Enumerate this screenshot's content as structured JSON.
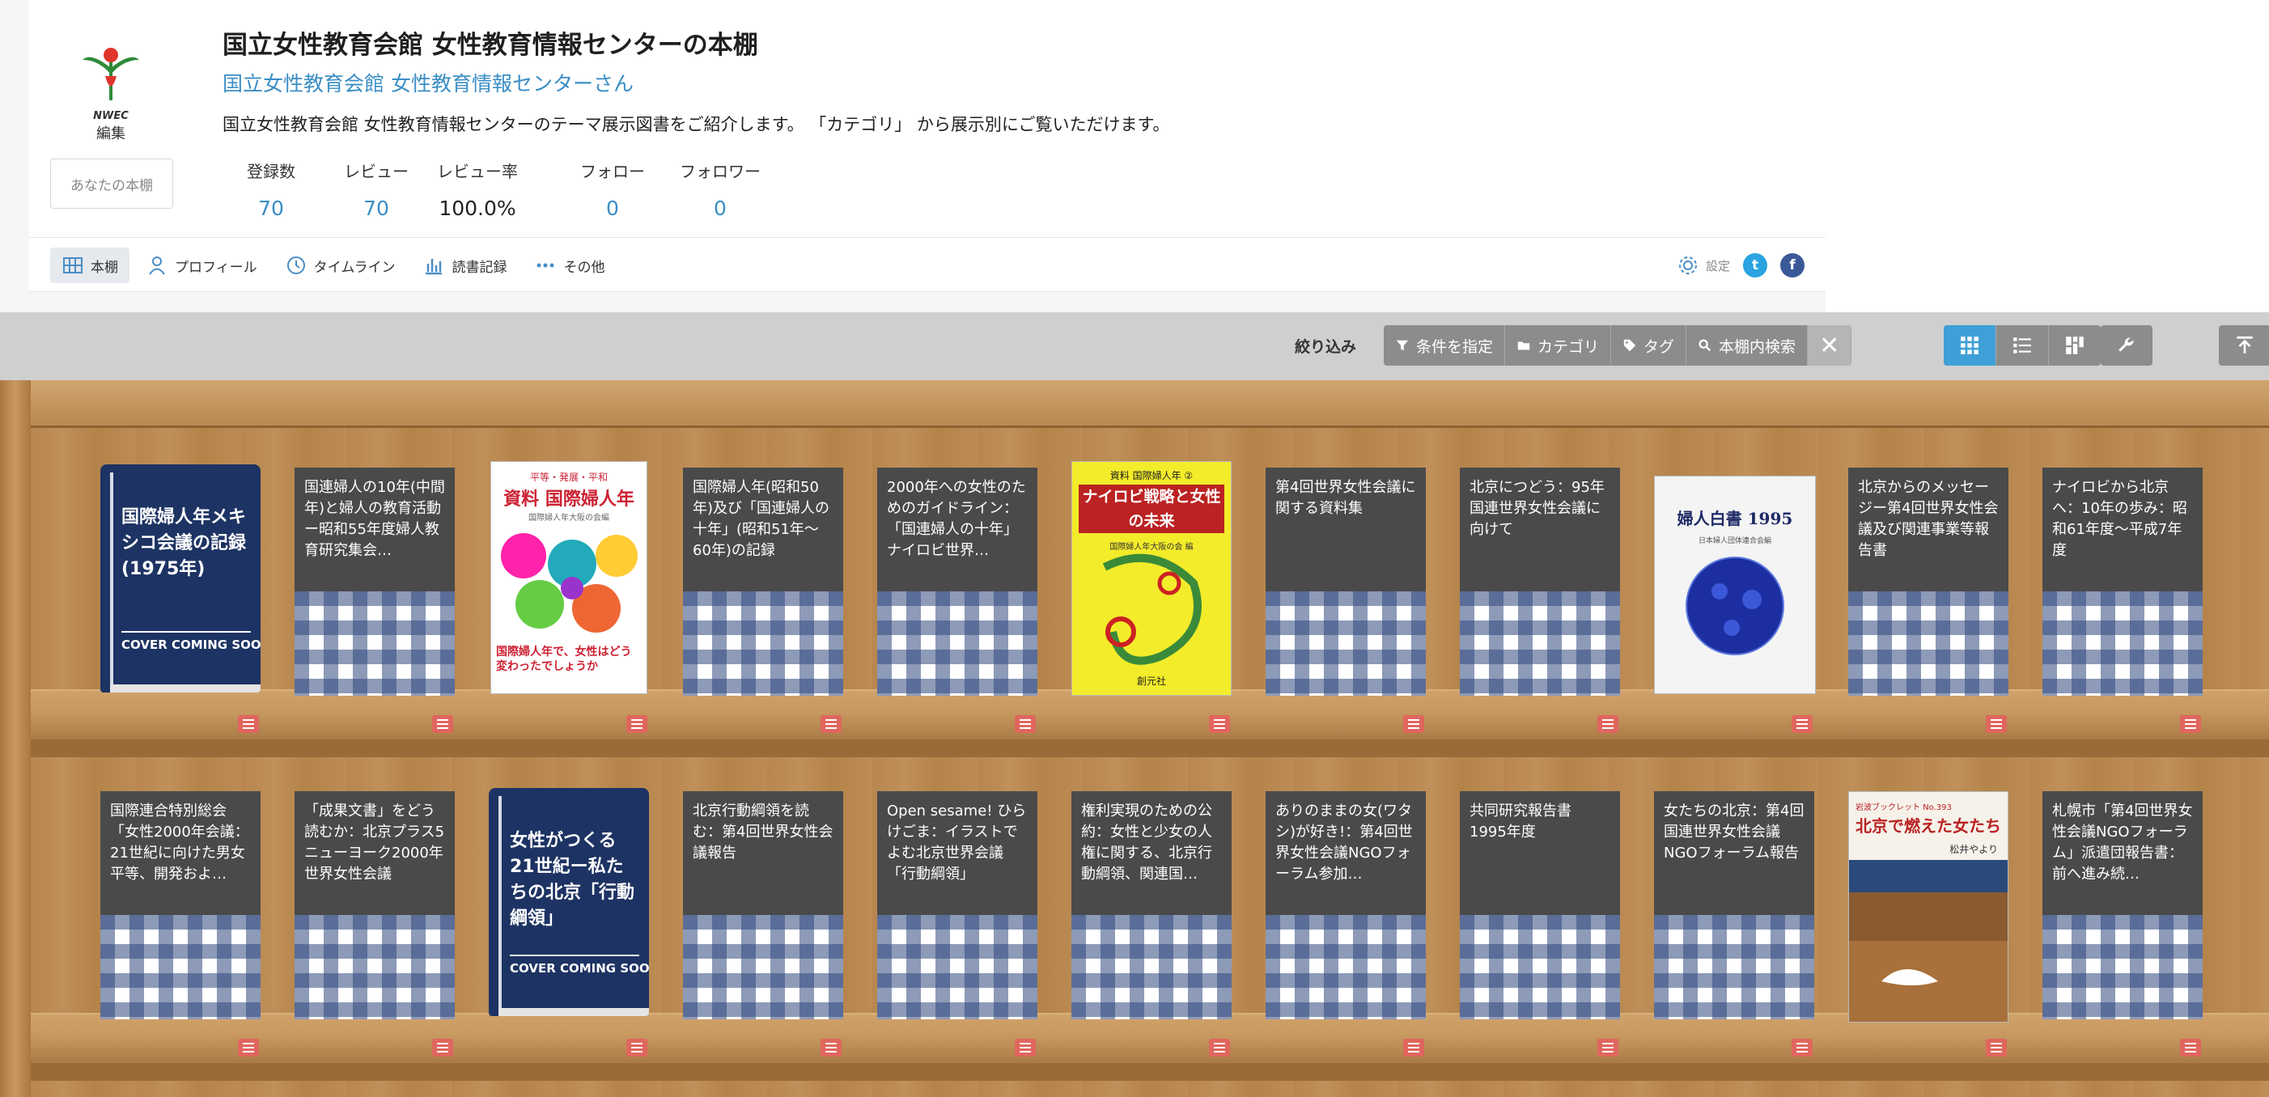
{
  "header": {
    "logo_brand": "NWEC",
    "logo_sub": "編集",
    "my_shelf_button": "あなたの本棚",
    "title": "国立女性教育会館 女性教育情報センターの本棚",
    "owner": "国立女性教育会館 女性教育情報センターさん",
    "description": "国立女性教育会館 女性教育情報センターのテーマ展示図書をご紹介します。 「カテゴリ」 から展示別にご覧いただけます。",
    "stats": {
      "registered_label": "登録数",
      "registered_value": "70",
      "reviews_label": "レビュー",
      "reviews_value": "70",
      "review_rate_label": "レビュー率",
      "review_rate_value": "100.0%",
      "follow_label": "フォロー",
      "follow_value": "0",
      "followers_label": "フォロワー",
      "followers_value": "0"
    },
    "nav": [
      "本棚",
      "プロフィール",
      "タイムライン",
      "読書記録",
      "その他"
    ],
    "settings_label": "設定",
    "twitter_glyph": "t",
    "facebook_glyph": "f"
  },
  "toolbar": {
    "filter_label": "絞り込み",
    "condition_button": "条件を指定",
    "category_button": "カテゴリ",
    "tag_button": "タグ",
    "search_button": "本棚内検索",
    "clear_glyph": "✕"
  },
  "colors": {
    "accent": "#3fa0d8",
    "link": "#3a8ec4",
    "memo": "#e0665e",
    "cover_navy": "#1d3363"
  },
  "books": {
    "row1": [
      {
        "kind": "nocover",
        "title": "国際婦人年メキシコ会議の記録 (1975年)",
        "cover_text": "COVER COMING SOON"
      },
      {
        "kind": "generic",
        "title": "国連婦人の10年(中間年)と婦人の教育活動ー昭和55年度婦人教育研究集会…"
      },
      {
        "kind": "cover1",
        "top_text": "平等・発展・平和",
        "main_text": "資料 国際婦人年",
        "sub_text": "国際婦人年大阪の会編",
        "bottom_text": "国際婦人年で、女性はどう変わったでしょうか"
      },
      {
        "kind": "generic",
        "title": "国際婦人年(昭和50年)及び「国連婦人の十年」(昭和51年〜60年)の記録"
      },
      {
        "kind": "generic",
        "title": "2000年への女性のためのガイドライン：「国連婦人の十年」ナイロビ世界…"
      },
      {
        "kind": "cover2",
        "top_text": "資料 国際婦人年 ②",
        "main_text": "ナイロビ戦略と女性の未来",
        "sub_text": "国際婦人年大阪の会 編",
        "publisher": "創元社"
      },
      {
        "kind": "generic",
        "title": "第4回世界女性会議に関する資料集"
      },
      {
        "kind": "generic",
        "title": "北京につどう：95年国連世界女性会議に向けて"
      },
      {
        "kind": "cover3",
        "main_text": "婦人白書 1995",
        "sub_text": "日本婦人団体連合会編"
      },
      {
        "kind": "generic",
        "title": "北京からのメッセージー第4回世界女性会議及び関連事業等報告書"
      },
      {
        "kind": "generic",
        "title": "ナイロビから北京へ：10年の歩み：昭和61年度〜平成7年度"
      }
    ],
    "row2": [
      {
        "kind": "generic",
        "title": "国際連合特別総会「女性2000年会議：21世紀に向けた男女平等、開発およ…"
      },
      {
        "kind": "generic",
        "title": "「成果文書」をどう読むか：北京プラス5ニューヨーク2000年世界女性会議"
      },
      {
        "kind": "nocover",
        "title": "女性がつくる 21世紀ー私たちの北京「行動綱領」",
        "cover_text": "COVER COMING SOON"
      },
      {
        "kind": "generic",
        "title": "北京行動綱領を読む：第4回世界女性会議報告"
      },
      {
        "kind": "generic",
        "title": "Open sesame! ひらけごま：イラストでよむ北京世界会議「行動綱領」"
      },
      {
        "kind": "generic",
        "title": "権利実現のための公約：女性と少女の人権に関する、北京行動綱領、関連国…"
      },
      {
        "kind": "generic",
        "title": "ありのままの女(ワタシ)が好き!：第4回世界女性会議NGOフォーラム参加…"
      },
      {
        "kind": "generic",
        "title": "共同研究報告書 1995年度"
      },
      {
        "kind": "generic",
        "title": "女たちの北京：第4回国連世界女性会議NGOフォーラム報告"
      },
      {
        "kind": "cover4",
        "top_text": "岩波ブックレット No.393",
        "main_text": "北京で燃えた女たち",
        "author": "松井やより"
      },
      {
        "kind": "generic",
        "title": "札幌市「第4回世界女性会議NGOフォーラム」派遣団報告書：前へ進み続…"
      }
    ]
  }
}
